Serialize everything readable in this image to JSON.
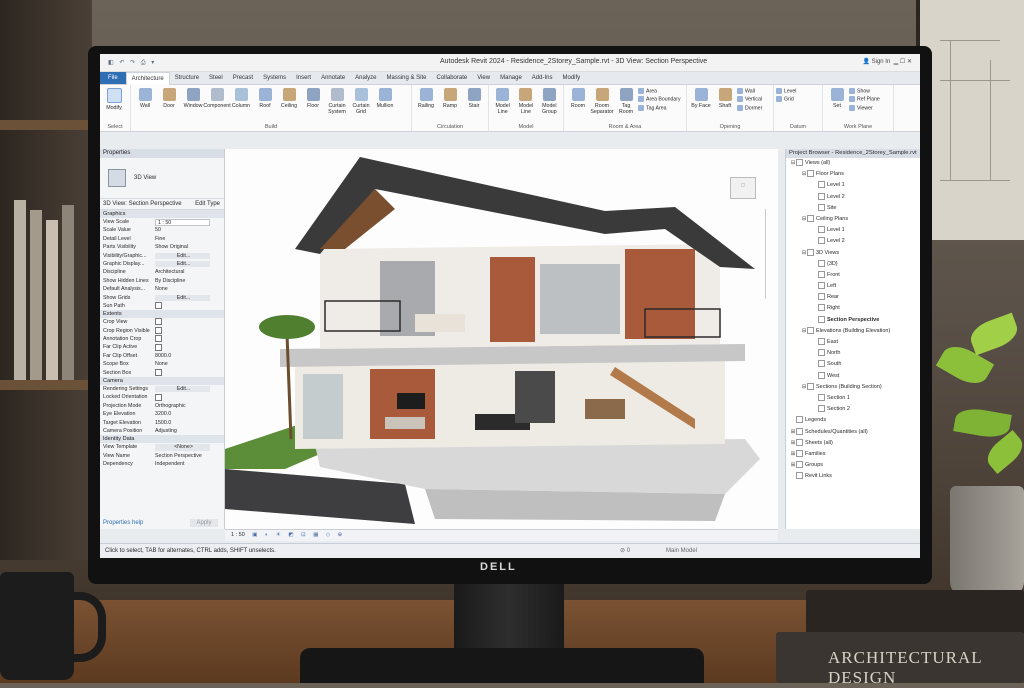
{
  "app": {
    "title": "Autodesk Revit 2024 - Residence_2Storey_Sample.rvt - 3D View: Section Perspective",
    "sign_in": "Sign In"
  },
  "ribbon_tabs": [
    "File",
    "Architecture",
    "Structure",
    "Steel",
    "Precast",
    "Systems",
    "Insert",
    "Annotate",
    "Analyze",
    "Massing & Site",
    "Collaborate",
    "View",
    "Manage",
    "Add-Ins",
    "Modify"
  ],
  "active_tab": "Architecture",
  "ribbon": {
    "select": {
      "modify": "Modify",
      "group": "Select"
    },
    "build": {
      "buttons": [
        "Wall",
        "Door",
        "Window",
        "Component",
        "Column",
        "Roof",
        "Ceiling",
        "Floor",
        "Curtain System",
        "Curtain Grid",
        "Mullion"
      ],
      "group": "Build"
    },
    "circulation": {
      "buttons": [
        "Railing",
        "Ramp",
        "Stair"
      ],
      "group": "Circulation"
    },
    "model": {
      "buttons": [
        "Model Line",
        "Model Line",
        "Model Group"
      ],
      "group": "Model"
    },
    "room": {
      "buttons": [
        "Room",
        "Room Separator",
        "Tag Room"
      ],
      "small": [
        "Area",
        "Area Boundary",
        "Tag Area"
      ],
      "group": "Room & Area"
    },
    "opening": {
      "buttons": [
        "By Face",
        "Shaft"
      ],
      "small": [
        "Wall",
        "Vertical",
        "Dormer"
      ],
      "group": "Opening"
    },
    "datum": {
      "small": [
        "Level",
        "Grid"
      ],
      "group": "Datum"
    },
    "workplane": {
      "buttons": [
        "Set"
      ],
      "small": [
        "Show",
        "Ref Plane",
        "Viewer"
      ],
      "group": "Work Plane"
    }
  },
  "properties": {
    "header": "Properties",
    "type_name": "3D View",
    "instance": "3D View: Section Perspective",
    "edit_type": "Edit Type",
    "sections": [
      {
        "name": "Graphics",
        "rows": [
          [
            "View Scale",
            "1 : 50"
          ],
          [
            "Scale Value",
            "50"
          ],
          [
            "Detail Level",
            "Fine"
          ],
          [
            "Parts Visibility",
            "Show Original"
          ],
          [
            "Visibility/Graphic...",
            "Edit..."
          ],
          [
            "Graphic Display...",
            "Edit..."
          ],
          [
            "Discipline",
            "Architectural"
          ],
          [
            "Show Hidden Lines",
            "By Discipline"
          ],
          [
            "Default Analysis...",
            "None"
          ],
          [
            "Show Grids",
            "Edit..."
          ],
          [
            "Sun Path",
            ""
          ]
        ]
      },
      {
        "name": "Extents",
        "rows": [
          [
            "Crop View",
            ""
          ],
          [
            "Crop Region Visible",
            ""
          ],
          [
            "Annotation Crop",
            ""
          ],
          [
            "Far Clip Active",
            ""
          ],
          [
            "Far Clip Offset",
            "8000.0"
          ],
          [
            "Scope Box",
            "None"
          ],
          [
            "Section Box",
            ""
          ]
        ]
      },
      {
        "name": "Camera",
        "rows": [
          [
            "Rendering Settings",
            "Edit..."
          ],
          [
            "Locked Orientation",
            ""
          ],
          [
            "Projection Mode",
            "Orthographic"
          ],
          [
            "Eye Elevation",
            "3200.0"
          ],
          [
            "Target Elevation",
            "1500.0"
          ],
          [
            "Camera Position",
            "Adjusting"
          ]
        ]
      },
      {
        "name": "Identity Data",
        "rows": [
          [
            "View Template",
            "<None>"
          ],
          [
            "View Name",
            "Section Perspective"
          ],
          [
            "Dependency",
            "Independent"
          ]
        ]
      }
    ],
    "help": "Properties help",
    "apply": "Apply"
  },
  "browser": {
    "header": "Project Browser - Residence_2Storey_Sample.rvt",
    "items": [
      {
        "t": "Views (all)",
        "lvl": 0,
        "exp": "-"
      },
      {
        "t": "Floor Plans",
        "lvl": 1,
        "exp": "-"
      },
      {
        "t": "Level 1",
        "lvl": 2
      },
      {
        "t": "Level 2",
        "lvl": 2
      },
      {
        "t": "Site",
        "lvl": 2
      },
      {
        "t": "Ceiling Plans",
        "lvl": 1,
        "exp": "-"
      },
      {
        "t": "Level 1",
        "lvl": 2
      },
      {
        "t": "Level 2",
        "lvl": 2
      },
      {
        "t": "3D Views",
        "lvl": 1,
        "exp": "-"
      },
      {
        "t": "{3D}",
        "lvl": 2
      },
      {
        "t": "Front",
        "lvl": 2
      },
      {
        "t": "Left",
        "lvl": 2
      },
      {
        "t": "Rear",
        "lvl": 2
      },
      {
        "t": "Right",
        "lvl": 2
      },
      {
        "t": "Section Perspective",
        "lvl": 2,
        "bold": true
      },
      {
        "t": "Elevations (Building Elevation)",
        "lvl": 1,
        "exp": "-"
      },
      {
        "t": "East",
        "lvl": 2
      },
      {
        "t": "North",
        "lvl": 2
      },
      {
        "t": "South",
        "lvl": 2
      },
      {
        "t": "West",
        "lvl": 2
      },
      {
        "t": "Sections (Building Section)",
        "lvl": 1,
        "exp": "-"
      },
      {
        "t": "Section 1",
        "lvl": 2
      },
      {
        "t": "Section 2",
        "lvl": 2
      },
      {
        "t": "Legends",
        "lvl": 0,
        "exp": ""
      },
      {
        "t": "Schedules/Quantities (all)",
        "lvl": 0,
        "exp": "+"
      },
      {
        "t": "Sheets (all)",
        "lvl": 0,
        "exp": "+"
      },
      {
        "t": "Families",
        "lvl": 0,
        "exp": "+"
      },
      {
        "t": "Groups",
        "lvl": 0,
        "exp": "+"
      },
      {
        "t": "Revit Links",
        "lvl": 0,
        "exp": ""
      }
    ]
  },
  "view_control": {
    "scale": "1 : 50"
  },
  "status": {
    "message": "Click to select, TAB for alternates, CTRL adds, SHIFT unselects.",
    "count": "0",
    "model": "Main Model"
  },
  "monitor_brand": "DELL",
  "book_title": "ARCHITECTURAL DESIGN",
  "colors": {
    "file_tab": "#2f6db5",
    "brick": "#a85a3a",
    "roof": "#3a3a3a"
  }
}
